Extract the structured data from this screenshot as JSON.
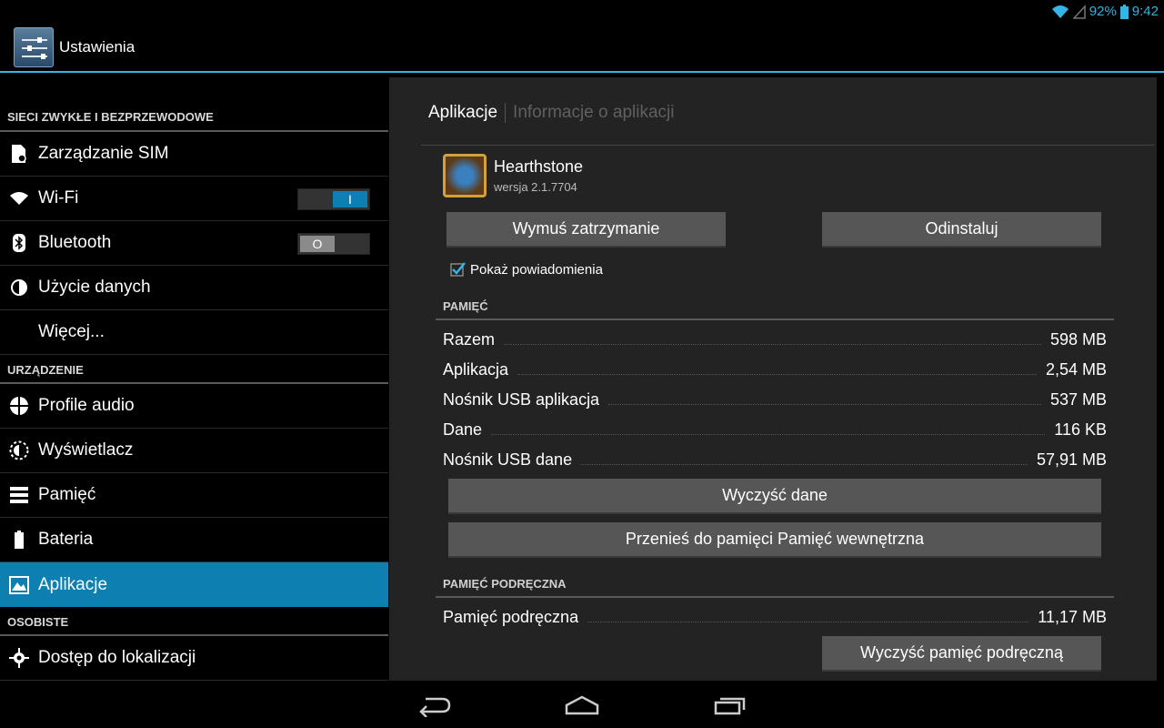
{
  "status_bar": {
    "battery": "92%",
    "time": "9:42",
    "icons": [
      "wifi-icon",
      "signal-icon"
    ]
  },
  "action_bar": {
    "title": "Ustawienia",
    "icon": "settings-sliders-icon"
  },
  "sidebar": {
    "categories": {
      "networks": "SIECI ZWYKŁE I BEZPRZEWODOWE",
      "device": "URZĄDZENIE",
      "personal": "OSOBISTE"
    },
    "items": {
      "sim": {
        "label": "Zarządzanie SIM",
        "icon": "sim-icon"
      },
      "wifi": {
        "label": "Wi-Fi",
        "icon": "wifi-icon",
        "toggle": "I"
      },
      "bluetooth": {
        "label": "Bluetooth",
        "icon": "bluetooth-icon",
        "toggle": "O"
      },
      "data": {
        "label": "Użycie danych",
        "icon": "data-usage-icon"
      },
      "more": {
        "label": "Więcej..."
      },
      "audio": {
        "label": "Profile audio",
        "icon": "audio-profile-icon"
      },
      "display": {
        "label": "Wyświetlacz",
        "icon": "brightness-icon"
      },
      "storage": {
        "label": "Pamięć",
        "icon": "storage-icon"
      },
      "battery": {
        "label": "Bateria",
        "icon": "battery-icon"
      },
      "apps": {
        "label": "Aplikacje",
        "icon": "apps-icon"
      },
      "location": {
        "label": "Dostęp do lokalizacji",
        "icon": "location-icon"
      }
    }
  },
  "panel": {
    "breadcrumb": {
      "current": "Aplikacje",
      "other": "Informacje o aplikacji"
    },
    "app": {
      "name": "Hearthstone",
      "version": "wersja 2.1.7704",
      "icon": "hearthstone-icon"
    },
    "buttons": {
      "force_stop": "Wymuś zatrzymanie",
      "uninstall": "Odinstaluj",
      "clear_data": "Wyczyść dane",
      "move": "Przenieś do pamięci Pamięć wewnętrzna",
      "clear_cache": "Wyczyść pamięć podręczną"
    },
    "notifications": {
      "label": "Pokaż powiadomienia",
      "checked": true
    },
    "storage": {
      "title": "PAMIĘĆ",
      "rows": [
        {
          "label": "Razem",
          "value": "598 MB"
        },
        {
          "label": "Aplikacja",
          "value": "2,54 MB"
        },
        {
          "label": "Nośnik USB aplikacja",
          "value": "537 MB"
        },
        {
          "label": "Dane",
          "value": "116 KB"
        },
        {
          "label": "Nośnik USB dane",
          "value": "57,91 MB"
        }
      ]
    },
    "cache": {
      "title": "PAMIĘĆ PODRĘCZNA",
      "rows": [
        {
          "label": "Pamięć podręczna",
          "value": "11,17 MB"
        }
      ]
    }
  },
  "nav_bar": {
    "icons": [
      "back-icon",
      "home-icon",
      "recents-icon"
    ]
  },
  "colors": {
    "accent": "#33b5e5",
    "selected": "#0d7fb0",
    "panel": "#232323"
  }
}
